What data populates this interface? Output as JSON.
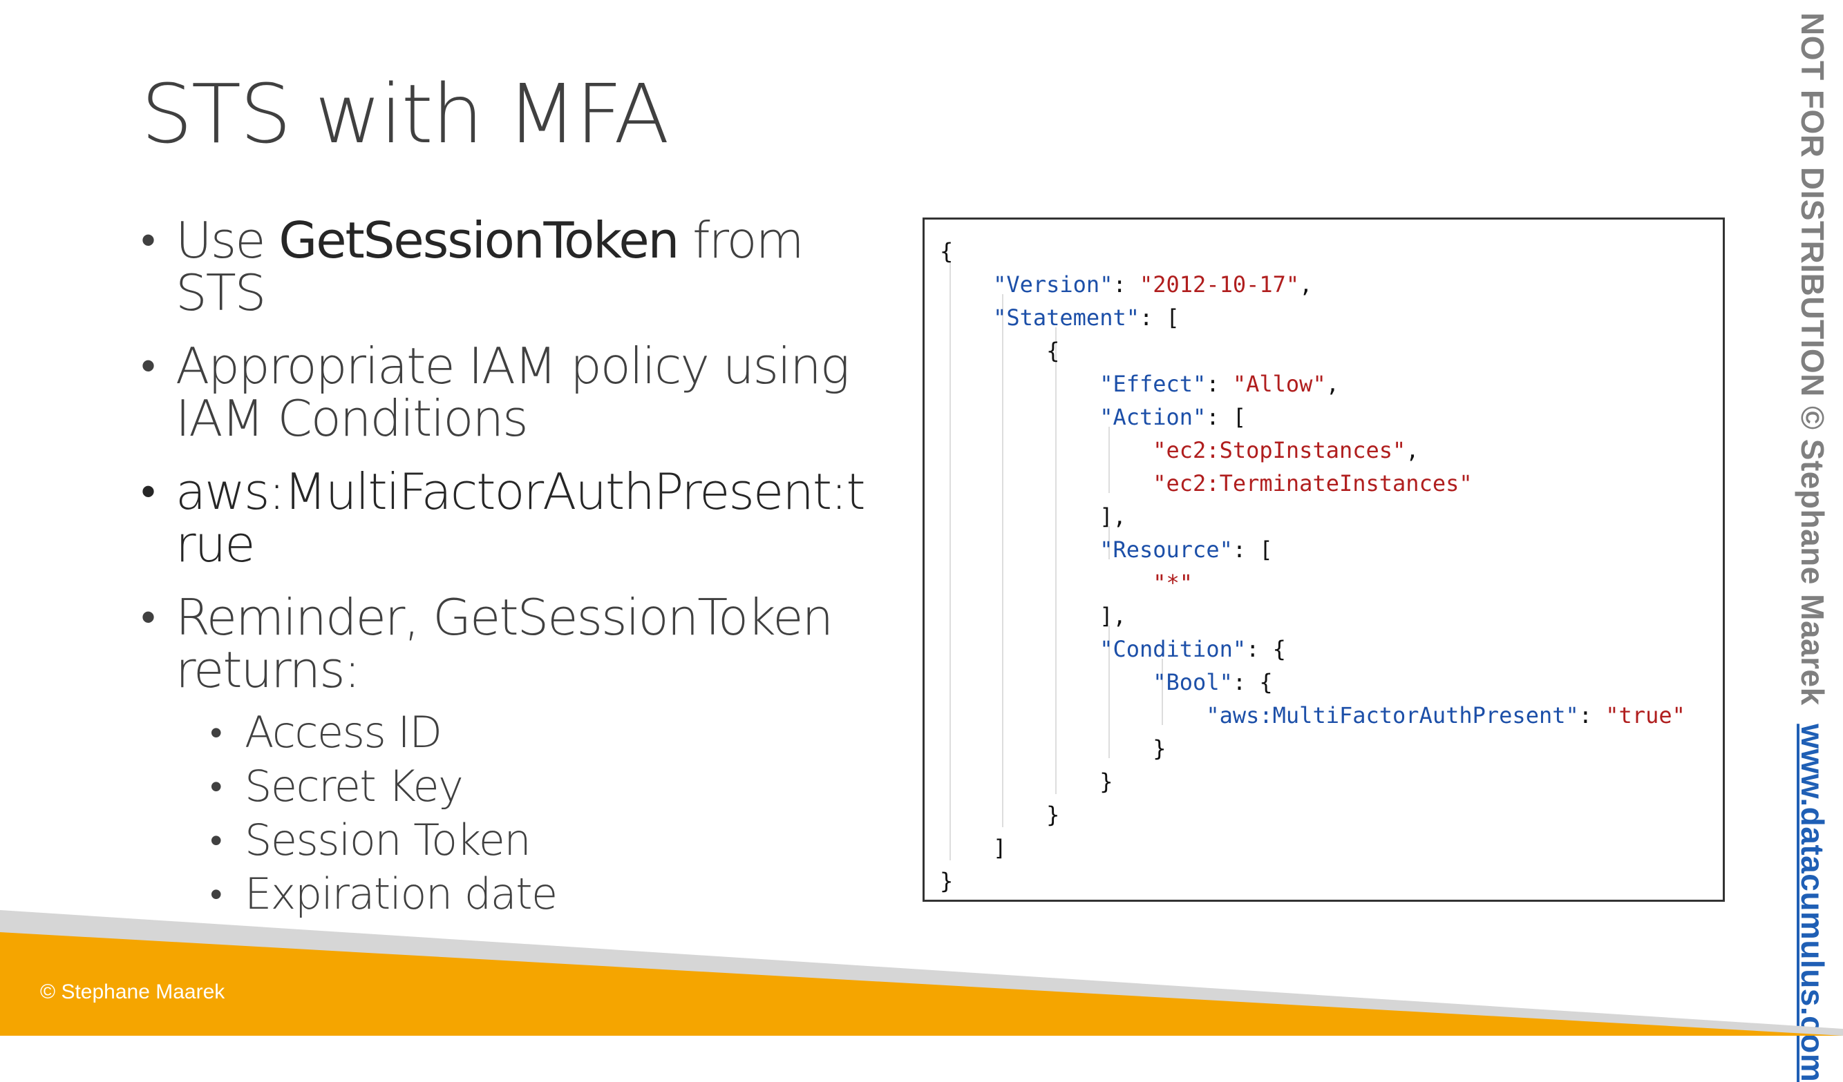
{
  "slide": {
    "title": "STS with MFA",
    "bullets": [
      {
        "pre": "Use ",
        "strong": "GetSessionToken",
        "post": " from STS"
      },
      {
        "text": "Appropriate IAM policy using IAM Conditions"
      },
      {
        "text": "aws:MultiFactorAuthPresent:true"
      },
      {
        "text": "Reminder, GetSessionToken returns:"
      }
    ],
    "sub_bullets": [
      "Access ID",
      "Secret Key",
      "Session Token",
      "Expiration date"
    ]
  },
  "policy_code": {
    "version_key": "\"Version\"",
    "version_val": "\"2012-10-17\"",
    "statement_key": "\"Statement\"",
    "effect_key": "\"Effect\"",
    "effect_val": "\"Allow\"",
    "action_key": "\"Action\"",
    "action_1": "\"ec2:StopInstances\"",
    "action_2": "\"ec2:TerminateInstances\"",
    "resource_key": "\"Resource\"",
    "resource_val": "\"*\"",
    "condition_key": "\"Condition\"",
    "bool_key": "\"Bool\"",
    "mfa_key": "\"aws:MultiFactorAuthPresent\"",
    "mfa_val": "\"true\""
  },
  "watermark": {
    "text": "NOT FOR DISTRIBUTION © Stephane Maarek",
    "link": "www.datacumulus.com"
  },
  "footer": {
    "copyright": "© Stephane Maarek",
    "colors": {
      "band": "#f5a500",
      "stripe": "#d6d6d6"
    }
  }
}
